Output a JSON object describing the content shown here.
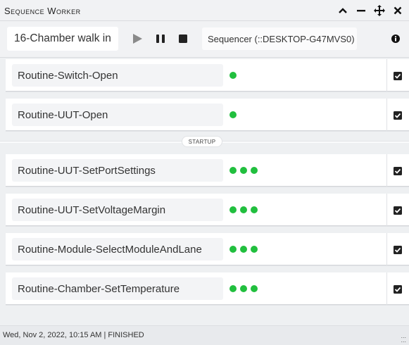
{
  "window": {
    "title": "Sequence Worker"
  },
  "toolbar": {
    "sequence_name": "16-Chamber walk in",
    "sequencer": "Sequencer (::DESKTOP-G47MVS0)"
  },
  "routines": [
    {
      "label": "Routine-Switch-Open",
      "dots": 1
    },
    {
      "label": "Routine-UUT-Open",
      "dots": 1
    },
    {
      "label": "Routine-UUT-SetPortSettings",
      "dots": 3
    },
    {
      "label": "Routine-UUT-SetVoltageMargin",
      "dots": 3
    },
    {
      "label": "Routine-Module-SelectModuleAndLane",
      "dots": 3
    },
    {
      "label": "Routine-Chamber-SetTemperature",
      "dots": 3
    }
  ],
  "separator_label": "STARTUP",
  "status": "Wed, Nov 2, 2022, 10:15 AM | FINISHED",
  "colors": {
    "dot": "#21bf3e",
    "row_bg": "#ffffff",
    "label_bg": "#f3f4f6"
  }
}
